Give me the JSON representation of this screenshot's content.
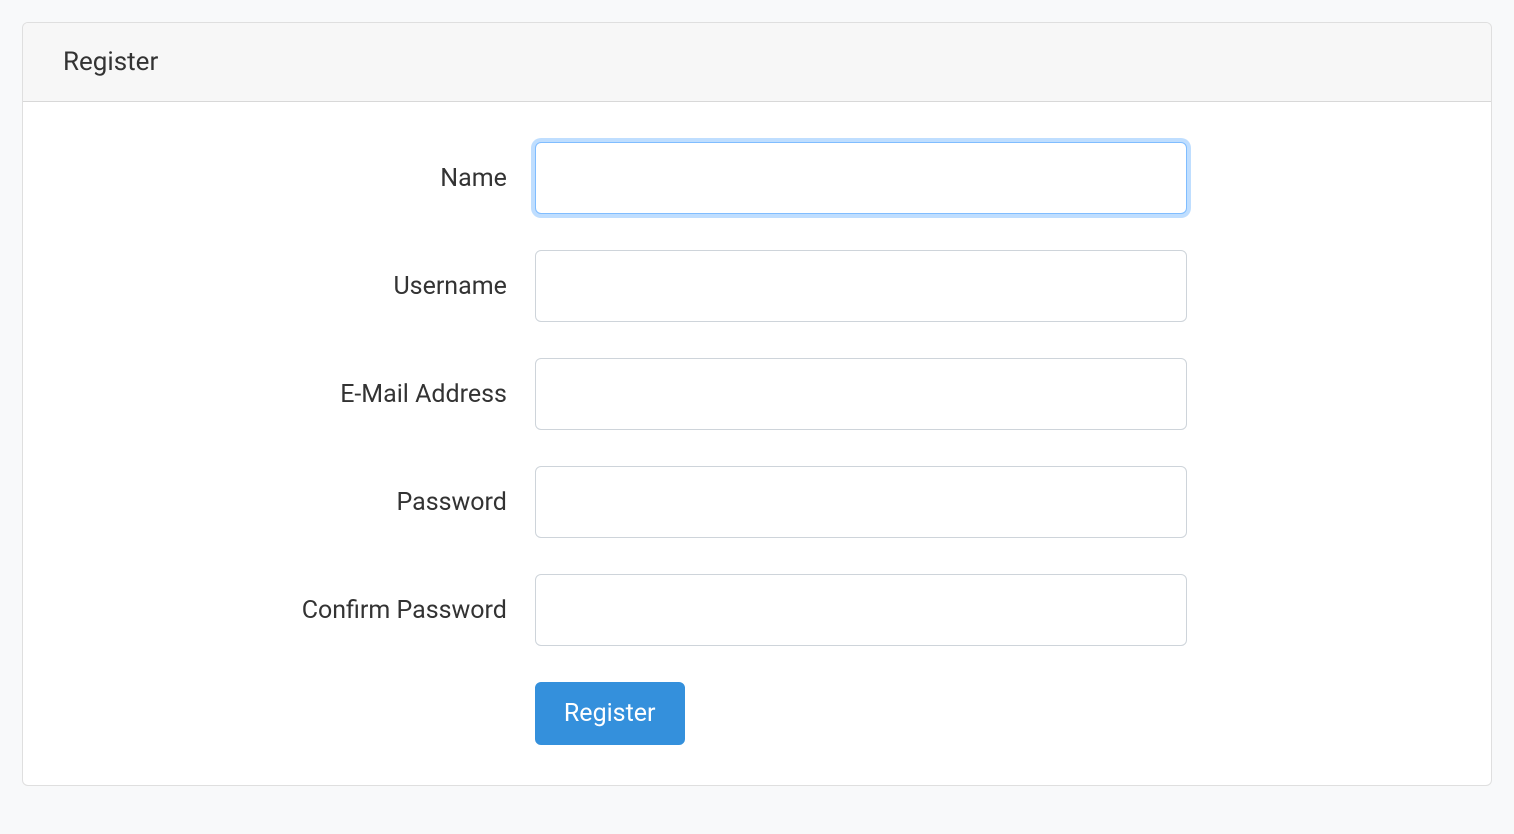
{
  "card": {
    "title": "Register"
  },
  "form": {
    "fields": {
      "name": {
        "label": "Name",
        "value": "",
        "focused": true
      },
      "username": {
        "label": "Username",
        "value": ""
      },
      "email": {
        "label": "E-Mail Address",
        "value": ""
      },
      "password": {
        "label": "Password",
        "value": ""
      },
      "confirm_password": {
        "label": "Confirm Password",
        "value": ""
      }
    },
    "submit_label": "Register"
  }
}
